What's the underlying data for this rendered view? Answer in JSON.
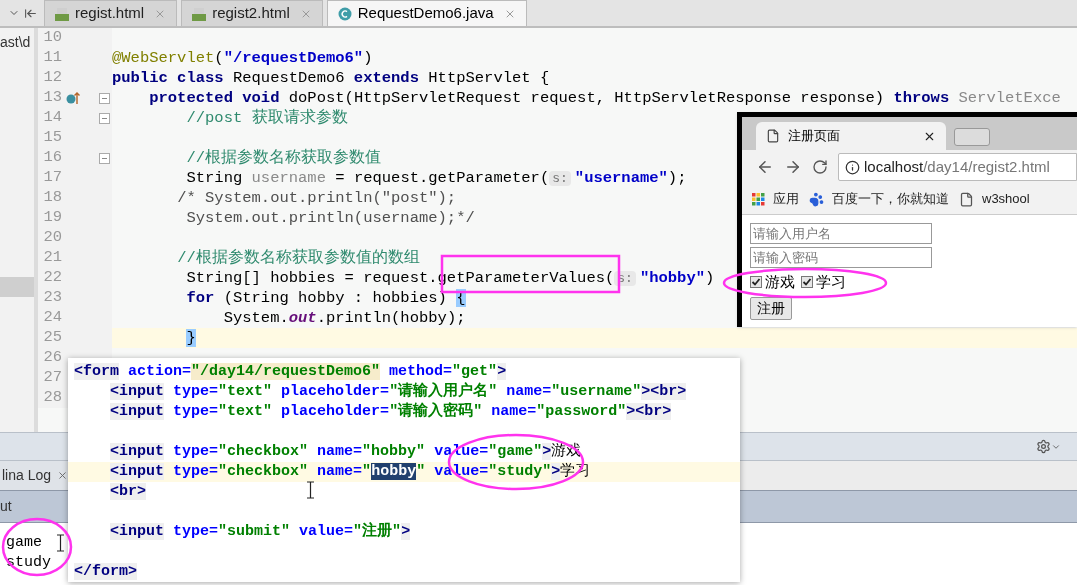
{
  "editor_tabs": [
    {
      "label": "regist.html",
      "kind": "html",
      "selected": false
    },
    {
      "label": "regist2.html",
      "kind": "html",
      "selected": false
    },
    {
      "label": "RequestDemo6.java",
      "kind": "java",
      "selected": true
    }
  ],
  "project_panel": {
    "path": "ast\\d"
  },
  "editor": {
    "lines": [
      {
        "number": "10",
        "current": false,
        "fold": false,
        "override": false
      },
      {
        "number": "11",
        "current": false,
        "fold": false,
        "override": false,
        "tokens": [
          {
            "text": "@WebServlet",
            "kind": "annotation"
          },
          {
            "text": "(",
            "kind": "plain"
          },
          {
            "text": "\"/requestDemo6\"",
            "kind": "string"
          },
          {
            "text": ")",
            "kind": "plain"
          }
        ]
      },
      {
        "number": "12",
        "current": false,
        "fold": false,
        "override": false,
        "tokens": [
          {
            "text": "public class",
            "kind": "keyword"
          },
          {
            "text": " RequestDemo6 ",
            "kind": "plain"
          },
          {
            "text": "extends",
            "kind": "keyword"
          },
          {
            "text": " HttpServlet {",
            "kind": "plain"
          }
        ]
      },
      {
        "number": "13",
        "current": false,
        "fold": true,
        "override": true,
        "tokens": [
          {
            "text": "    protected void",
            "kind": "keyword"
          },
          {
            "text": " doPost(HttpServletRequest request, HttpServletResponse response) ",
            "kind": "plain"
          },
          {
            "text": "throws",
            "kind": "keyword"
          },
          {
            "text": " ServletExce",
            "kind": "faded"
          }
        ]
      },
      {
        "number": "14",
        "current": false,
        "fold": true,
        "override": false,
        "tokens": [
          {
            "text": "        //post 获取请求参数",
            "kind": "comment"
          }
        ]
      },
      {
        "number": "15",
        "current": false,
        "fold": false,
        "override": false
      },
      {
        "number": "16",
        "current": false,
        "fold": true,
        "override": false,
        "tokens": [
          {
            "text": "        //根据参数名称获取参数值",
            "kind": "comment"
          }
        ]
      },
      {
        "number": "17",
        "current": false,
        "fold": false,
        "override": false,
        "tokens": [
          {
            "text": "        String ",
            "kind": "plain"
          },
          {
            "text": "username",
            "kind": "unused"
          },
          {
            "text": " = request.getParameter(",
            "kind": "plain"
          },
          {
            "text": "s:",
            "kind": "hint"
          },
          {
            "text": "\"username\"",
            "kind": "string"
          },
          {
            "text": ");",
            "kind": "plain"
          }
        ]
      },
      {
        "number": "18",
        "current": false,
        "fold": false,
        "override": false,
        "tokens": [
          {
            "text": "       /* System.out.println(\"post\");",
            "kind": "block_comment"
          }
        ]
      },
      {
        "number": "19",
        "current": false,
        "fold": false,
        "override": false,
        "tokens": [
          {
            "text": "        System.out.println(username);*/",
            "kind": "block_comment"
          }
        ]
      },
      {
        "number": "20",
        "current": false,
        "fold": false,
        "override": false
      },
      {
        "number": "21",
        "current": false,
        "fold": false,
        "override": false,
        "tokens": [
          {
            "text": "       //根据参数名称获取参数值的数组",
            "kind": "comment"
          }
        ]
      },
      {
        "number": "22",
        "current": false,
        "fold": false,
        "override": false,
        "tokens": [
          {
            "text": "        String[] hobbies = request.getParameterValues(",
            "kind": "plain"
          },
          {
            "text": "s:",
            "kind": "hint"
          },
          {
            "text": "\"hobby\"",
            "kind": "string"
          },
          {
            "text": ")",
            "kind": "plain"
          }
        ]
      },
      {
        "number": "23",
        "current": false,
        "fold": false,
        "override": false,
        "tokens": [
          {
            "text": "        for",
            "kind": "keyword"
          },
          {
            "text": " (String hobby : hobbies) ",
            "kind": "plain"
          },
          {
            "text": "{",
            "kind": "brace_match"
          }
        ]
      },
      {
        "number": "24",
        "current": false,
        "fold": false,
        "override": false,
        "tokens": [
          {
            "text": "            System.",
            "kind": "plain"
          },
          {
            "text": "out",
            "kind": "static"
          },
          {
            "text": ".println(hobby);",
            "kind": "plain"
          }
        ]
      },
      {
        "number": "25",
        "current": true,
        "fold": false,
        "override": false,
        "tokens": [
          {
            "text": "        }",
            "kind": "brace_match"
          }
        ]
      },
      {
        "number": "26",
        "current": false
      },
      {
        "number": "27",
        "current": false
      },
      {
        "number": "28",
        "current": false
      }
    ]
  },
  "browser": {
    "tab_title": "注册页面",
    "host": "localhost",
    "path": "/day14/regist2.html",
    "bookmarks": [
      {
        "label": "应用",
        "kind": "apps"
      },
      {
        "label": "百度一下，你就知道",
        "kind": "paw"
      },
      {
        "label": "w3shool",
        "kind": "page"
      }
    ],
    "fields": [
      {
        "placeholder": "请输入用户名"
      },
      {
        "placeholder": "请输入密码"
      }
    ],
    "checkboxes": [
      {
        "label": "游戏",
        "checked": true
      },
      {
        "label": "学习",
        "checked": true
      }
    ],
    "submit": "注册"
  },
  "snippet": {
    "lines": [
      {
        "current": false,
        "tokens": [
          {
            "text": "<form",
            "kind": "tag"
          },
          {
            "text": " action=",
            "kind": "attr"
          },
          {
            "text": "\"/day14/requestDemo6\"",
            "kind": "string_hl"
          },
          {
            "text": " method=",
            "kind": "attr"
          },
          {
            "text": "\"get\"",
            "kind": "string"
          },
          {
            "text": ">",
            "kind": "tag"
          }
        ]
      },
      {
        "current": false,
        "tokens": [
          {
            "text": "    <input",
            "kind": "tag"
          },
          {
            "text": " type=",
            "kind": "attr"
          },
          {
            "text": "\"text\"",
            "kind": "string"
          },
          {
            "text": " placeholder=",
            "kind": "attr"
          },
          {
            "text": "\"请输入用户名\"",
            "kind": "string"
          },
          {
            "text": " name=",
            "kind": "attr"
          },
          {
            "text": "\"username\"",
            "kind": "string"
          },
          {
            "text": "><br>",
            "kind": "tag"
          }
        ]
      },
      {
        "current": false,
        "tokens": [
          {
            "text": "    <input",
            "kind": "tag"
          },
          {
            "text": " type=",
            "kind": "attr"
          },
          {
            "text": "\"text\"",
            "kind": "string"
          },
          {
            "text": " placeholder=",
            "kind": "attr"
          },
          {
            "text": "\"请输入密码\"",
            "kind": "string"
          },
          {
            "text": " name=",
            "kind": "attr"
          },
          {
            "text": "\"password\"",
            "kind": "string"
          },
          {
            "text": "><br>",
            "kind": "tag"
          }
        ]
      },
      {
        "current": false
      },
      {
        "current": false,
        "tokens": [
          {
            "text": "    <input",
            "kind": "tag"
          },
          {
            "text": " type=",
            "kind": "attr"
          },
          {
            "text": "\"checkbox\"",
            "kind": "string"
          },
          {
            "text": " name=",
            "kind": "attr"
          },
          {
            "text": "\"hobby\"",
            "kind": "string"
          },
          {
            "text": " value=",
            "kind": "attr"
          },
          {
            "text": "\"game\"",
            "kind": "string"
          },
          {
            "text": ">",
            "kind": "tag"
          },
          {
            "text": "游戏",
            "kind": "text"
          }
        ]
      },
      {
        "current": true,
        "tokens": [
          {
            "text": "    <input",
            "kind": "tag"
          },
          {
            "text": " type=",
            "kind": "attr"
          },
          {
            "text": "\"checkbox\"",
            "kind": "string"
          },
          {
            "text": " name=",
            "kind": "attr"
          },
          {
            "text": "\"",
            "kind": "string"
          },
          {
            "text": "hobby",
            "kind": "selection"
          },
          {
            "text": "\"",
            "kind": "string"
          },
          {
            "text": " value=",
            "kind": "attr"
          },
          {
            "text": "\"study\"",
            "kind": "string"
          },
          {
            "text": ">",
            "kind": "tag"
          },
          {
            "text": "学习",
            "kind": "text"
          }
        ]
      },
      {
        "current": false,
        "tokens": [
          {
            "text": "    <br>",
            "kind": "tag"
          }
        ]
      },
      {
        "current": false
      },
      {
        "current": false,
        "tokens": [
          {
            "text": "    <input",
            "kind": "tag"
          },
          {
            "text": " type=",
            "kind": "attr"
          },
          {
            "text": "\"submit\"",
            "kind": "string"
          },
          {
            "text": " value=",
            "kind": "attr"
          },
          {
            "text": "\"注册\"",
            "kind": "string"
          },
          {
            "text": ">",
            "kind": "tag"
          }
        ]
      },
      {
        "current": false
      },
      {
        "current": false,
        "tokens": [
          {
            "text": "</form>",
            "kind": "tag"
          }
        ]
      }
    ]
  },
  "bottom_panel": {
    "tab": "lina Log",
    "header": "ut",
    "output": [
      "game",
      "study"
    ]
  }
}
